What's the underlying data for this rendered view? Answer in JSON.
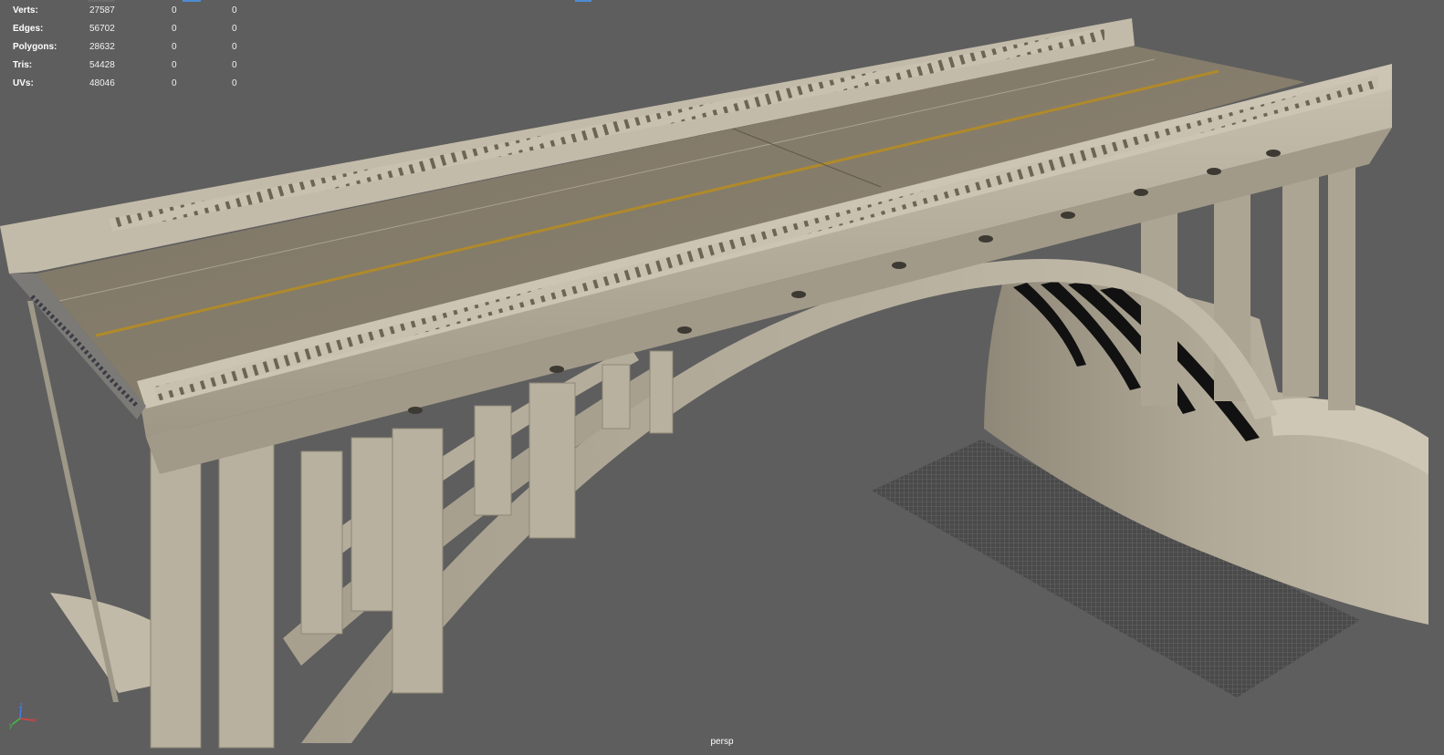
{
  "viewport": {
    "camera": "persp"
  },
  "hud": {
    "rows": [
      {
        "label": "Verts:",
        "value": "27587",
        "selected": "0",
        "components": "0"
      },
      {
        "label": "Edges:",
        "value": "56702",
        "selected": "0",
        "components": "0"
      },
      {
        "label": "Polygons:",
        "value": "28632",
        "selected": "0",
        "components": "0"
      },
      {
        "label": "Tris:",
        "value": "54428",
        "selected": "0",
        "components": "0"
      },
      {
        "label": "UVs:",
        "value": "48046",
        "selected": "0",
        "components": "0"
      }
    ]
  },
  "axis_gizmo": {
    "x": "x",
    "y": "y",
    "z": "z",
    "colors": {
      "x": "#e04040",
      "y": "#40c040",
      "z": "#4a7ae0"
    }
  },
  "colors": {
    "background": "#5e5e5e",
    "concrete": "#b3ab9a",
    "road": "#857c6b",
    "lane_line": "#b08a2a",
    "selection_accent": "#4d8bd0"
  }
}
